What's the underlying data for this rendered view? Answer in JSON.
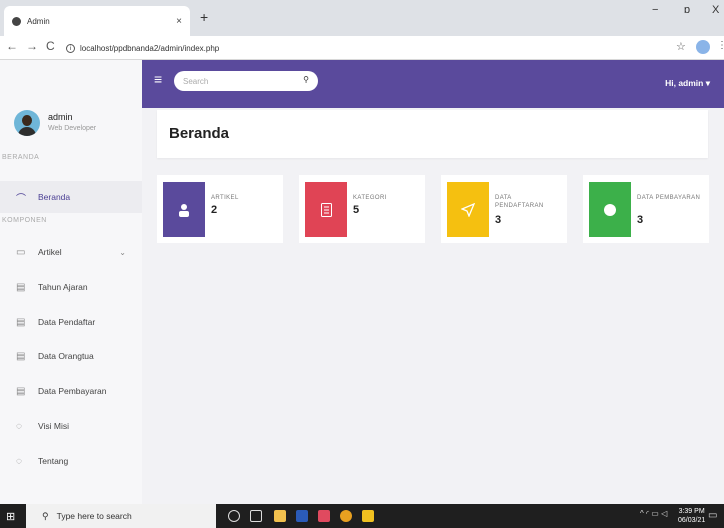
{
  "browser": {
    "tab_title": "Admin",
    "tab_close": "×",
    "new_tab": "+",
    "url": "localhost/ppdbnanda2/admin/index.php",
    "nav_back": "←",
    "nav_forward": "→",
    "nav_reload": "C",
    "win_min": "−",
    "win_max": "ɒ",
    "win_close": "X"
  },
  "sidebar": {
    "user_name": "admin",
    "user_role": "Web Developer",
    "section_main": "BERANDA",
    "section_components": "KOMPONEN",
    "items": [
      {
        "label": "Beranda",
        "icon": "⌒"
      },
      {
        "label": "Artikel",
        "icon": "▭",
        "chevron": "⌄"
      },
      {
        "label": "Tahun Ajaran",
        "icon": "▤"
      },
      {
        "label": "Data Pendaftar",
        "icon": "▤"
      },
      {
        "label": "Data Orangtua",
        "icon": "▤"
      },
      {
        "label": "Data Pembayaran",
        "icon": "▤"
      },
      {
        "label": "Visi Misi",
        "icon": "◌"
      },
      {
        "label": "Tentang",
        "icon": "◌"
      }
    ]
  },
  "header": {
    "menu_icon": "≡",
    "search_placeholder": "Search",
    "search_icon": "⚲",
    "greeting": "Hi, admin ▾"
  },
  "page": {
    "title": "Beranda"
  },
  "cards": [
    {
      "label": "ARTIKEL",
      "value": "2",
      "color": "#5a4a9c",
      "icon": "person-icon"
    },
    {
      "label": "KATEGORI",
      "value": "5",
      "color": "#e04455",
      "icon": "document-icon"
    },
    {
      "label": "DATA PENDAFTARAN",
      "value": "3",
      "color": "#f5c010",
      "icon": "send-icon"
    },
    {
      "label": "DATA PEMBAYARAN",
      "value": "3",
      "color": "#3cb04a",
      "icon": "circle-icon"
    }
  ],
  "taskbar": {
    "search_text": "Type here to search",
    "time": "3:39 PM",
    "date": "06/03/21"
  }
}
